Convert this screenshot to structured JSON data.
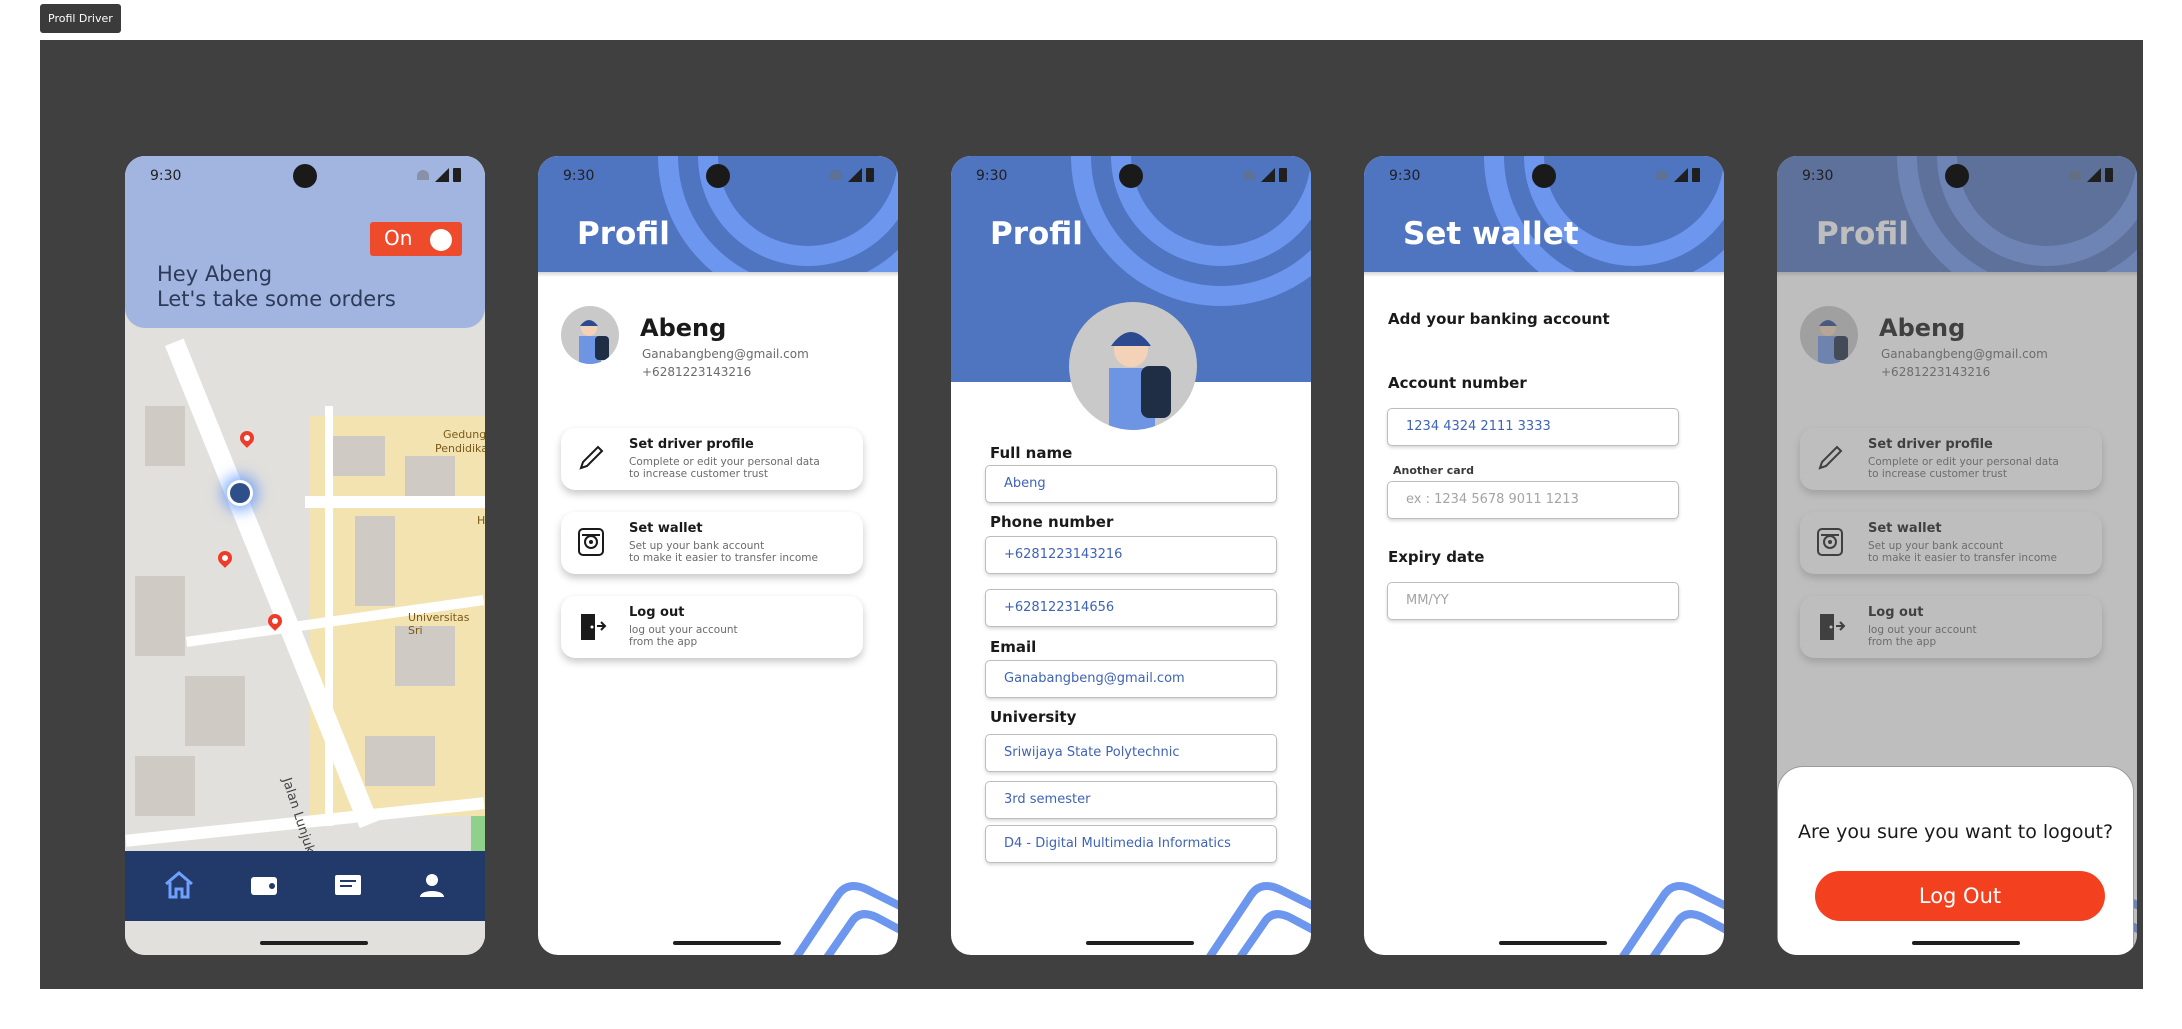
{
  "frame_label": "Profil Driver",
  "status": {
    "time": "9:30"
  },
  "home": {
    "greeting_line1": "Hey Abeng",
    "greeting_line2": "Let's take some orders",
    "toggle_label": "On",
    "map_labels": [
      "Gedung",
      "Pendidikan",
      "Universitas Sri",
      "Jalan Lunjuk Jaya",
      "H"
    ],
    "tabs": [
      "home-icon",
      "wallet-icon",
      "chat-icon",
      "profile-icon"
    ]
  },
  "profile": {
    "title": "Profil",
    "name": "Abeng",
    "email": "Ganabangbeng@gmail.com",
    "phone": "+6281223143216",
    "menu": [
      {
        "title": "Set driver profile",
        "desc1": "Complete or edit your personal data",
        "desc2": "to increase customer trust",
        "icon": "pencil-icon"
      },
      {
        "title": "Set wallet",
        "desc1": "Set up your bank account",
        "desc2": "to make it easier to transfer income",
        "icon": "wallet-safe-icon"
      },
      {
        "title": "Log out",
        "desc1": "log out your account",
        "desc2": "from the app",
        "icon": "logout-door-icon"
      }
    ]
  },
  "edit_profile": {
    "title": "Profil",
    "full_name_label": "Full name",
    "full_name": "Abeng",
    "phone_label": "Phone number",
    "phone1": "+6281223143216",
    "phone2": "+628122314656",
    "email_label": "Email",
    "email": "Ganabangbeng@gmail.com",
    "university_label": "University",
    "university": "Sriwijaya State Polytechnic",
    "semester": "3rd semester",
    "program": "D4 - Digital Multimedia Informatics"
  },
  "wallet": {
    "title": "Set wallet",
    "subtitle": "Add your banking account",
    "account_label": "Account number",
    "account_value": "1234 4324 2111 3333",
    "another_card_label": "Another card",
    "another_card_placeholder": "ex : 1234  5678 9011 1213",
    "expiry_label": "Expiry date",
    "expiry_placeholder": "MM/YY"
  },
  "logout_dialog": {
    "question": "Are you sure you want to logout?",
    "button": "Log Out"
  },
  "colors": {
    "brand_blue": "#4f74c0",
    "accent_red": "#f3401f",
    "tab_bar": "#213a6a",
    "canvas": "#404040"
  }
}
